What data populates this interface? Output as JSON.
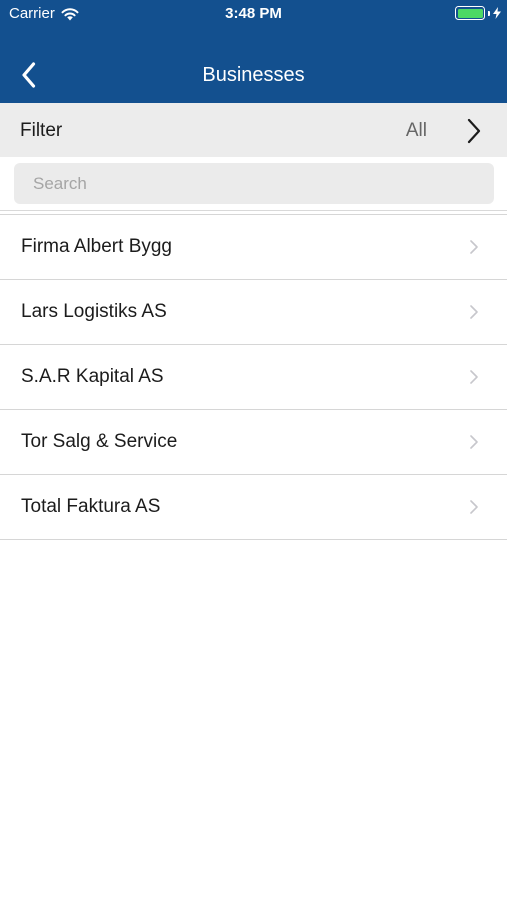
{
  "status_bar": {
    "carrier": "Carrier",
    "time": "3:48 PM",
    "battery_color": "#4cd964"
  },
  "nav": {
    "back_icon": "chevron-left-icon",
    "title": "Businesses",
    "background_color": "#13508f"
  },
  "filter": {
    "label": "Filter",
    "value": "All"
  },
  "search": {
    "placeholder": "Search",
    "value": ""
  },
  "businesses": [
    {
      "label": "Firma Albert Bygg"
    },
    {
      "label": "Lars Logistiks AS"
    },
    {
      "label": "S.A.R Kapital AS"
    },
    {
      "label": "Tor Salg & Service"
    },
    {
      "label": "Total Faktura AS"
    }
  ]
}
